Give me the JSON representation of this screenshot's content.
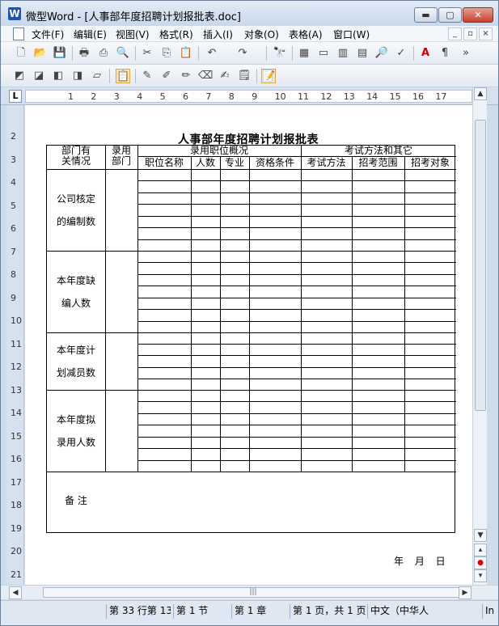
{
  "window": {
    "title": "微型Word - [人事部年度招聘计划报批表.doc]",
    "app_badge": "W"
  },
  "menu": [
    "文件(F)",
    "编辑(E)",
    "视图(V)",
    "格式(R)",
    "插入(I)",
    "对象(O)",
    "表格(A)",
    "窗口(W)"
  ],
  "mdi_buttons": [
    "_",
    "▫",
    "×"
  ],
  "toolbar1": [
    "new-icon",
    "open-icon",
    "save-icon",
    "print-icon",
    "pdf-icon",
    "print-preview-icon",
    "cut-icon",
    "copy-icon",
    "paste-icon",
    "undo-icon",
    "redo-icon",
    "find-icon",
    "table-insert-icon",
    "frame-icon",
    "columns-icon",
    "page-view-icon",
    "zoom-icon",
    "spell-icon",
    "font-color-icon",
    "style-icon",
    "overflow-icon"
  ],
  "toolbar2": [
    "tool-a-icon",
    "tool-b-icon",
    "tool-c-icon",
    "tool-d-icon",
    "tool-e-icon",
    "clipboard-icon",
    "pen-icon",
    "marker-icon",
    "brush-icon",
    "eraser-icon",
    "draw-icon",
    "notes-icon",
    "form-icon"
  ],
  "ruler": {
    "h_ticks": [
      "1",
      "2",
      "3",
      "4",
      "5",
      "6",
      "7",
      "8",
      "9",
      "10",
      "11",
      "12",
      "13",
      "14",
      "15",
      "16",
      "17"
    ],
    "v_ticks": [
      "2",
      "3",
      "4",
      "5",
      "6",
      "7",
      "8",
      "9",
      "10",
      "11",
      "12",
      "13",
      "14",
      "15",
      "16",
      "17",
      "18",
      "19",
      "20",
      "21"
    ]
  },
  "document": {
    "table_title": "人事部年度招聘计划报批表",
    "col_dept": "部门有关情况",
    "col_dept_l1": "部门有",
    "col_dept_l2": "关情况",
    "col_recruit_l1": "录用",
    "col_recruit_l2": "部门",
    "group_position": "录用职位概况",
    "group_exam": "考试方法和其它",
    "sub_headers": [
      "职位名称",
      "人数",
      "专业",
      "资格条件",
      "考试方法",
      "招考范围",
      "招考对象"
    ],
    "row_groups": [
      {
        "l1": "公司核定",
        "l2": "的编制数"
      },
      {
        "l1": "本年度缺",
        "l2": "编人数"
      },
      {
        "l1": "本年度计",
        "l2": "划减员数"
      },
      {
        "l1": "本年度拟",
        "l2": "录用人数"
      }
    ],
    "remarks_label": "备  注",
    "date_line": "年 月 日"
  },
  "status": [
    "第 33 行第 13",
    "第 1 节",
    "第 1 章",
    "第 1 页，共 1 页",
    "中文（中华人",
    "In"
  ]
}
